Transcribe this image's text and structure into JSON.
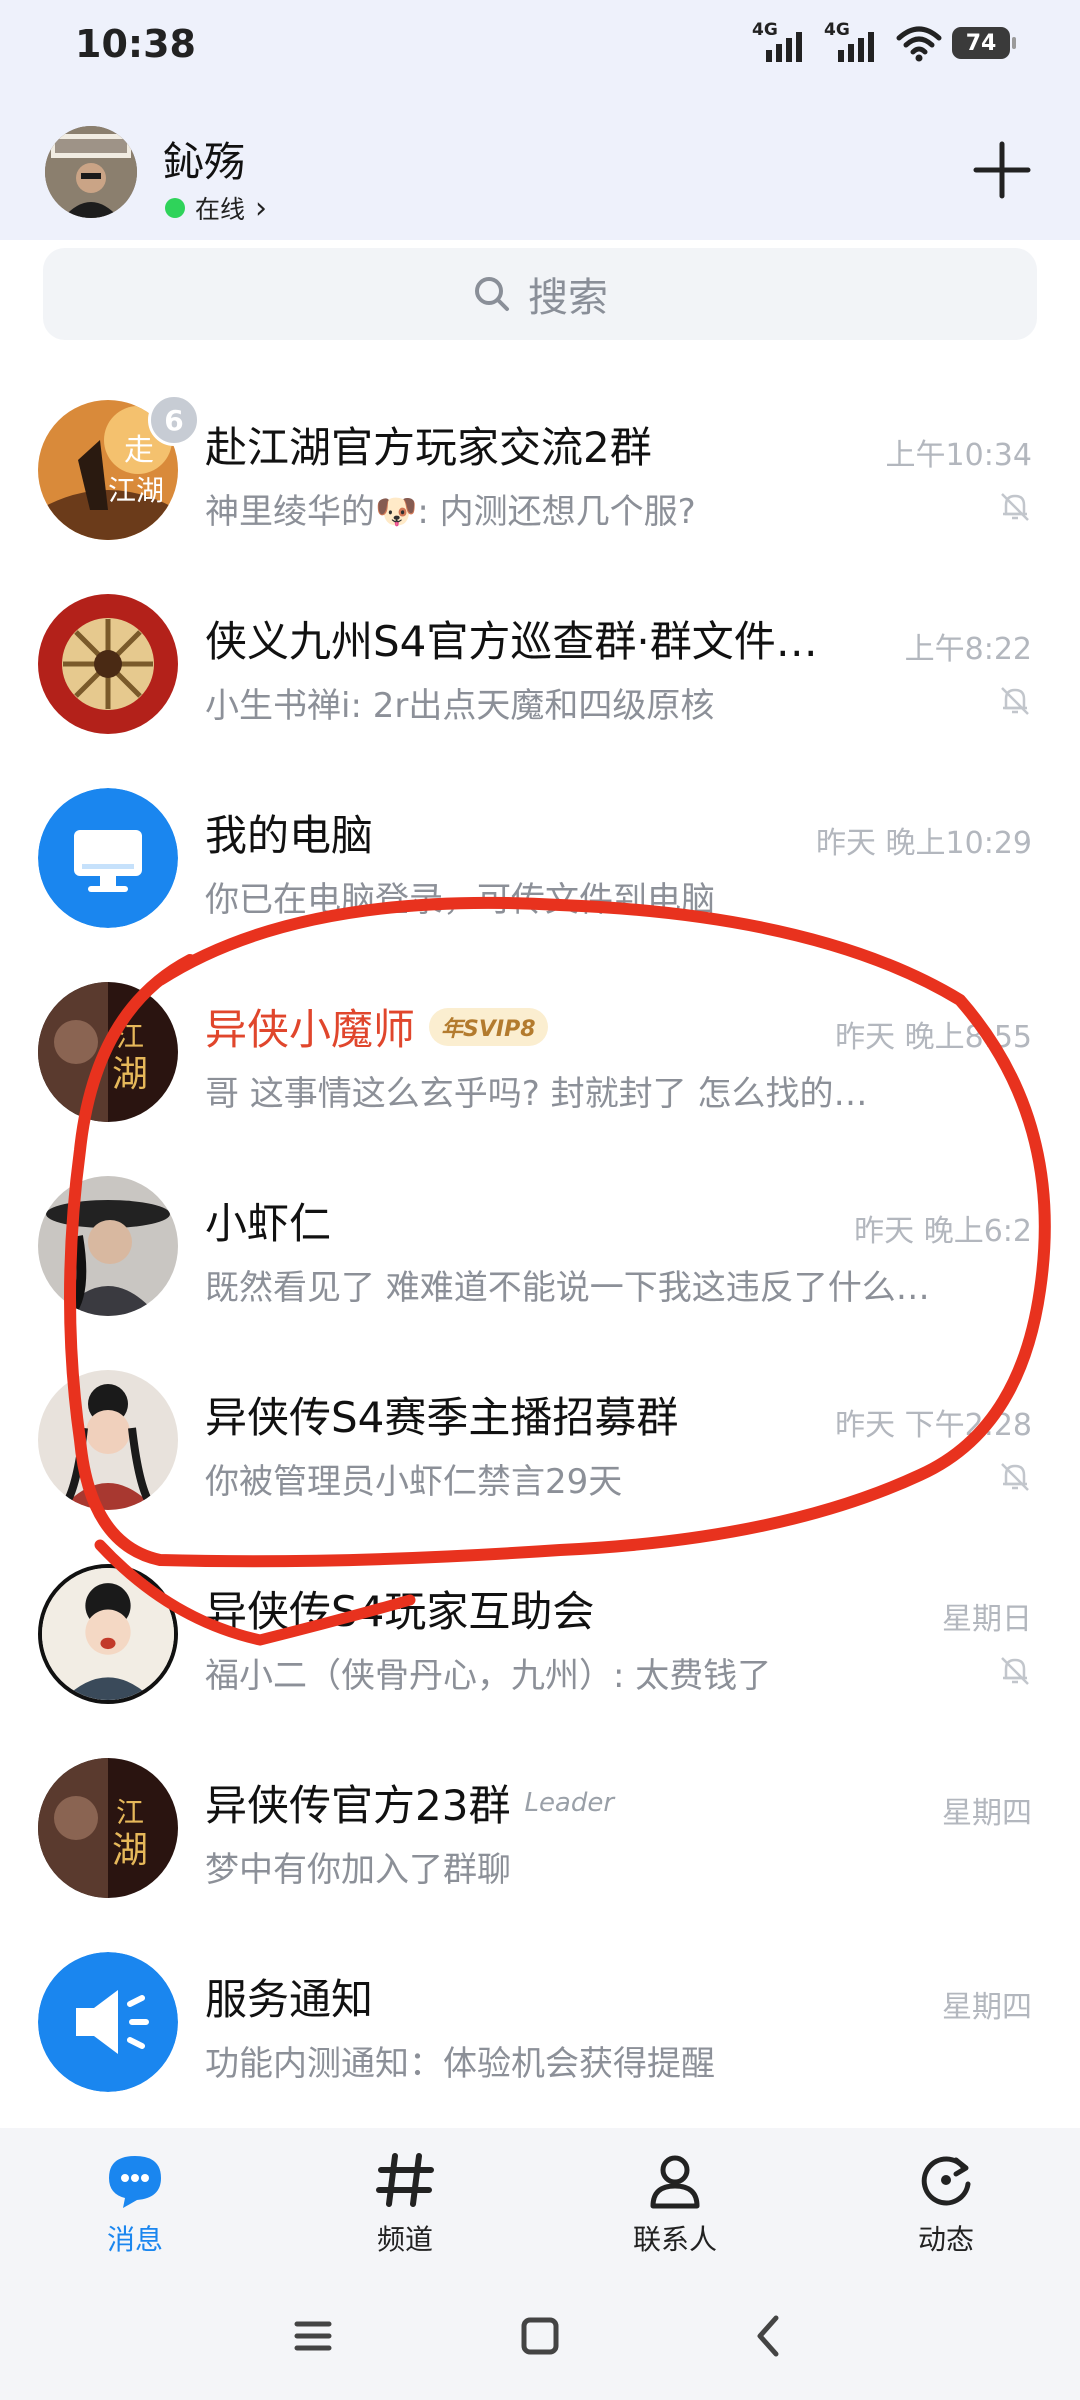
{
  "status_bar": {
    "time": "10:38",
    "network1": "4G",
    "network2": "4G",
    "battery": "74"
  },
  "header": {
    "user_name": "鈊殇",
    "status": "在线",
    "status_chevron": "›",
    "avatar_icon": "user-avatar"
  },
  "search": {
    "placeholder": "搜索"
  },
  "chats": [
    {
      "name": "赴江湖官方玩家交流2群",
      "time": "上午10:34",
      "preview": "神里绫华的🐶: 内测还想几个服?",
      "unread": "6",
      "muted": true
    },
    {
      "name": "侠义九州S4官方巡查群·群文件…",
      "time": "上午8:22",
      "preview": "小生书禅i: 2r出点天魔和四级原核",
      "muted": true
    },
    {
      "name": "我的电脑",
      "time": "昨天 晚上10:29",
      "preview": "你已在电脑登录，可传文件到电脑",
      "muted": false
    },
    {
      "name": "异侠小魔师",
      "badge": "年SVIP8",
      "time": "昨天 晚上8:55",
      "preview": "哥 这事情这么玄乎吗?    封就封了 怎么找的…",
      "muted": false
    },
    {
      "name": "小虾仁",
      "time": "昨天 晚上6:2",
      "preview": "既然看见了 难难道不能说一下我这违反了什么…",
      "muted": false
    },
    {
      "name": "异侠传S4赛季主播招募群",
      "time": "昨天 下午2:28",
      "preview": "你被管理员小虾仁禁言29天",
      "muted": true
    },
    {
      "name": "异侠传S4玩家互助会",
      "time": "星期日",
      "preview": "福小二（侠骨丹心，九州）: 太费钱了",
      "muted": true
    },
    {
      "name": "异侠传官方23群",
      "tag": "Leader",
      "time": "星期四",
      "preview": "梦中有你加入了群聊",
      "muted": false
    },
    {
      "name": "服务通知",
      "time": "星期四",
      "preview": "功能内测通知：体验机会获得提醒",
      "muted": false
    }
  ],
  "tabs": [
    {
      "label": "消息",
      "icon": "message-icon",
      "active": true
    },
    {
      "label": "频道",
      "icon": "hash-icon",
      "active": false
    },
    {
      "label": "联系人",
      "icon": "contacts-icon",
      "active": false
    },
    {
      "label": "动态",
      "icon": "refresh-icon",
      "active": false
    }
  ],
  "colors": {
    "accent": "#1a86ef",
    "vip_name": "#e0462c",
    "annotation": "#e8321e",
    "online": "#2fd35a"
  }
}
